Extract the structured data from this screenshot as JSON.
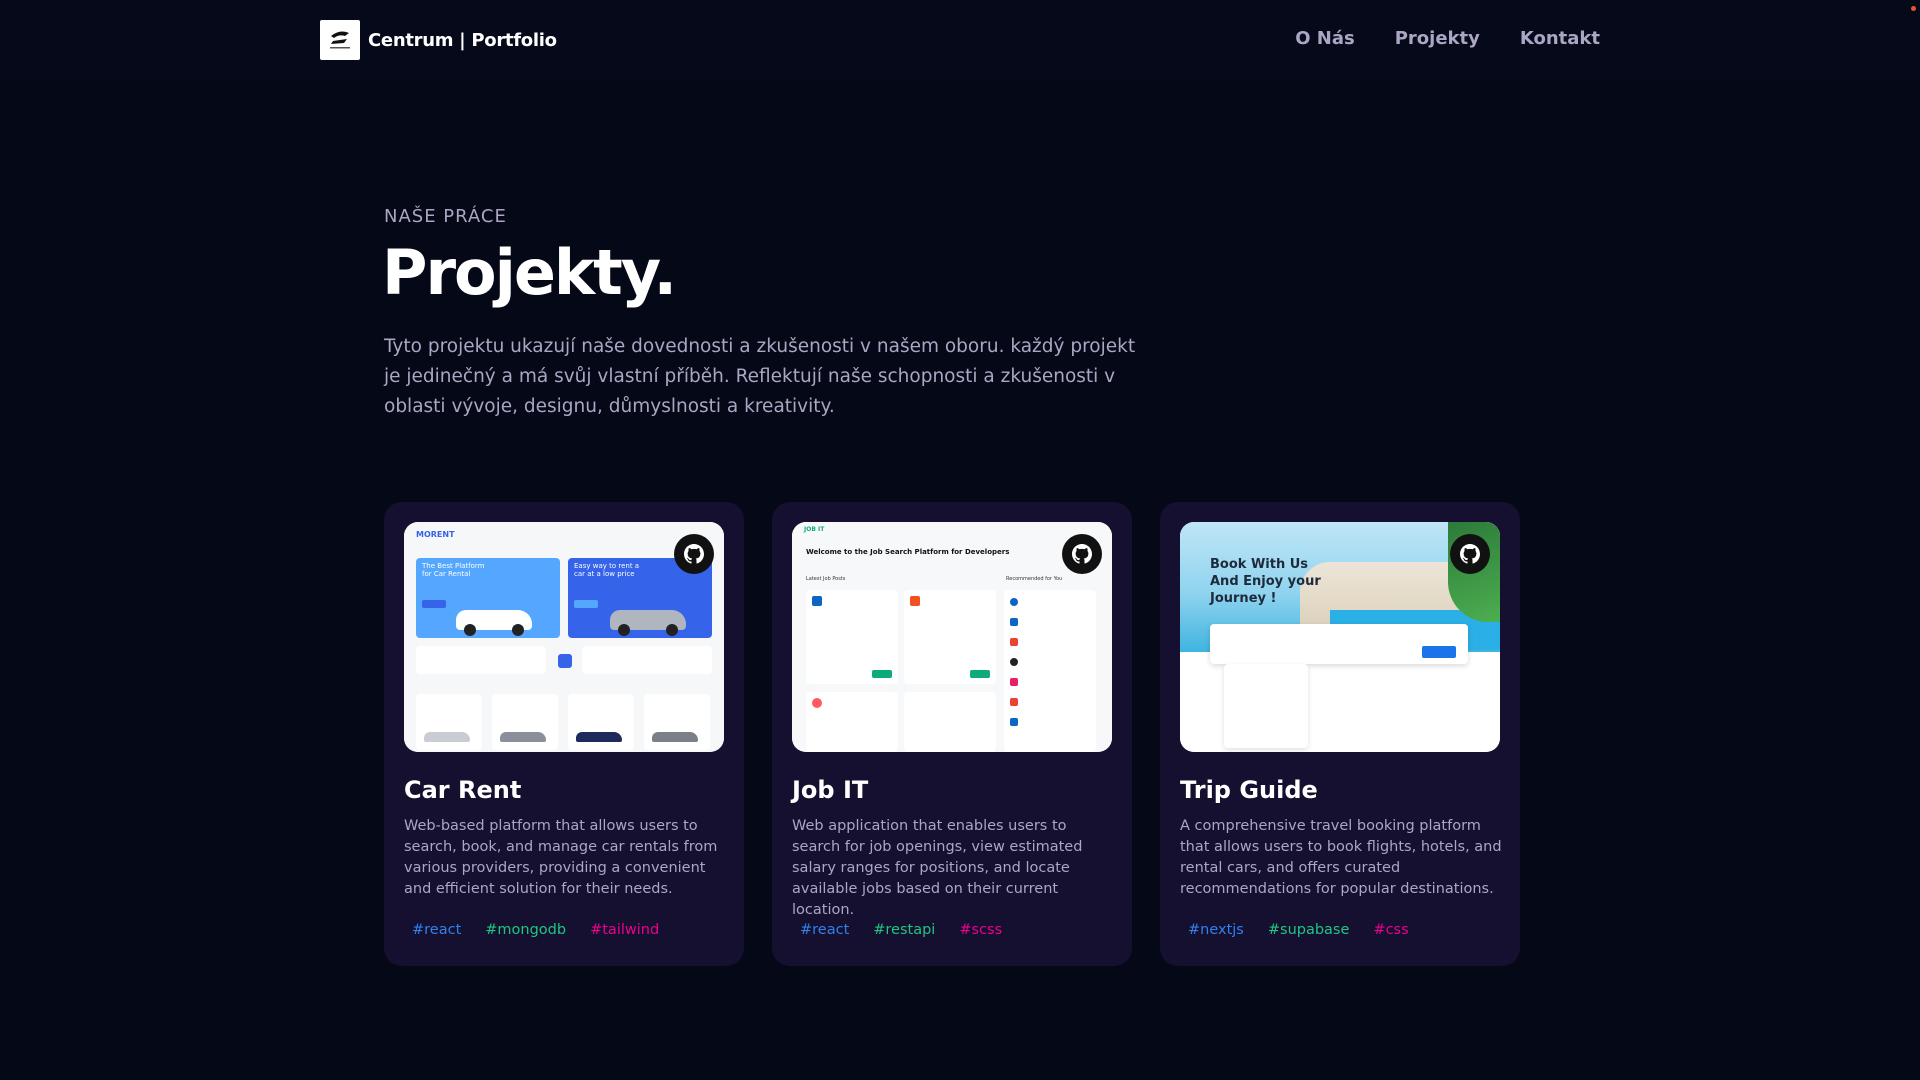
{
  "nav": {
    "brand": "Centrum | Portfolio",
    "links": [
      "O Nás",
      "Projekty",
      "Kontakt"
    ]
  },
  "hero": {
    "subtitle": "NAŠE PRÁCE",
    "title": "Projekty.",
    "description": "Tyto projektu ukazují naše dovednosti a zkušenosti v našem oboru. každý projekt je jedinečný a má svůj vlastní příběh. Reflektují naše schopnosti a zkušenosti v oblasti vývoje, designu, důmyslnosti a kreativity."
  },
  "projects": [
    {
      "title": "Car Rent",
      "description": "Web-based platform that allows users to search, book, and manage car rentals from various providers, providing a convenient and efficient solution for their needs.",
      "tags": [
        "#react",
        "#mongodb",
        "#tailwind"
      ],
      "icon": "github-icon",
      "thumb": {
        "brand": "MORENT",
        "promo_1": "The Best Platform for Car Rental",
        "promo_2": "Easy way to rent a car at a low price"
      }
    },
    {
      "title": "Job IT",
      "description": "Web application that enables users to search for job openings, view estimated salary ranges for positions, and locate available jobs based on their current location.",
      "tags": [
        "#react",
        "#restapi",
        "#scss"
      ],
      "icon": "github-icon",
      "thumb": {
        "brand": "JOB IT",
        "welcome": "Welcome to the Job Search Platform for Developers",
        "section": "Latest Job Posts",
        "side": "Recommended for You"
      }
    },
    {
      "title": "Trip Guide",
      "description": "A comprehensive travel booking platform that allows users to book flights, hotels, and rental cars, and offers curated recommendations for popular destinations.",
      "tags": [
        "#nextjs",
        "#supabase",
        "#css"
      ],
      "icon": "github-icon",
      "thumb": {
        "headline": "Book With Us And Enjoy your Journey !"
      }
    }
  ],
  "colors": {
    "background": "#050816",
    "card": "#151030",
    "secondary_text": "#aaa6c3",
    "tag_blue": "#2f80ed",
    "tag_green": "#20c580",
    "tag_pink": "#ec008c"
  }
}
